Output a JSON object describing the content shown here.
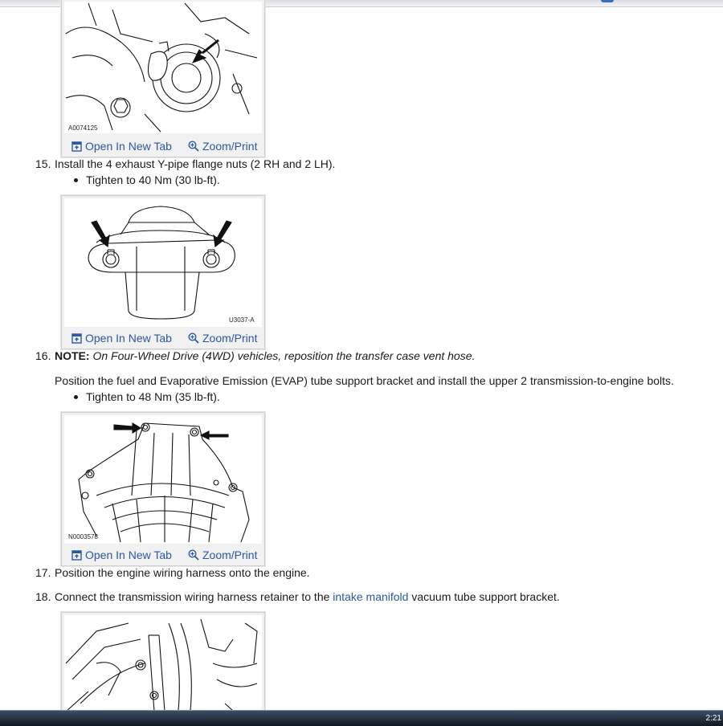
{
  "figures": [
    {
      "code": "A0074125",
      "open_label": "Open In New Tab",
      "zoom_label": "Zoom/Print"
    },
    {
      "code": "U3037-A",
      "open_label": "Open In New Tab",
      "zoom_label": "Zoom/Print"
    },
    {
      "code": "N0003578",
      "open_label": "Open In New Tab",
      "zoom_label": "Zoom/Print"
    },
    {
      "code": ""
    }
  ],
  "steps": {
    "s15": {
      "num": "15.",
      "text": "Install the 4 exhaust Y-pipe flange nuts (2 RH and 2 LH).",
      "bullet": "Tighten to 40 Nm (30 lb-ft)."
    },
    "s16": {
      "num": "16.",
      "note_label": "NOTE:",
      "note_text": "On Four-Wheel Drive (4WD) vehicles, reposition the transfer case vent hose.",
      "text": "Position the fuel and Evaporative Emission (EVAP) tube support bracket and install the upper 2 transmission-to-engine bolts.",
      "bullet": "Tighten to 48 Nm (35 lb-ft)."
    },
    "s17": {
      "num": "17.",
      "text": "Position the engine wiring harness onto the engine."
    },
    "s18": {
      "num": "18.",
      "text_before": "Connect the transmission wiring harness retainer to the ",
      "link": "intake manifold",
      "text_after": " vacuum tube support bracket."
    }
  },
  "taskbar": {
    "clock": "2:21"
  },
  "colors": {
    "link": "#2b58a3",
    "figure_frame": "#cfcfcf"
  },
  "icons": {
    "open": "open-new-tab-icon",
    "zoom": "zoom-icon"
  }
}
